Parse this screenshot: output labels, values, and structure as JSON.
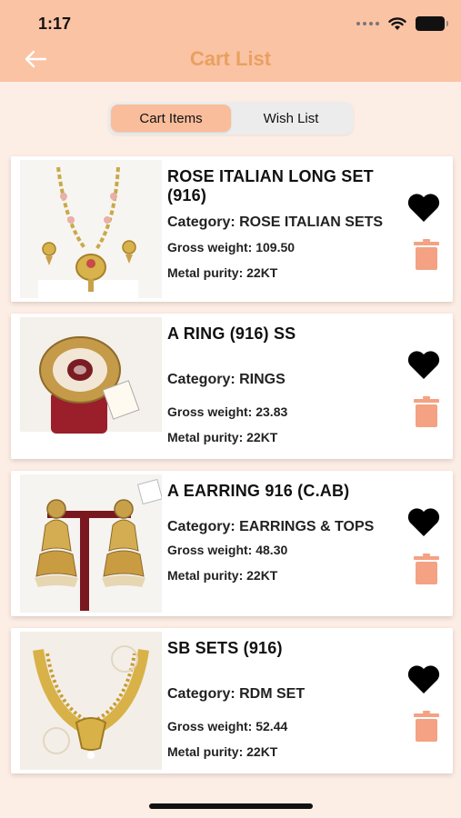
{
  "status_bar": {
    "time": "1:17"
  },
  "header": {
    "title": "Cart List"
  },
  "tabs": [
    {
      "label": "Cart Items",
      "active": true
    },
    {
      "label": "Wish List",
      "active": false
    }
  ],
  "colors": {
    "header_bg": "#fac3a4",
    "accent": "#e9a060",
    "trash": "#f4a283",
    "page_bg": "#fdeee5"
  },
  "items": [
    {
      "title": "ROSE ITALIAN LONG SET (916)",
      "category": "Category: ROSE ITALIAN SETS",
      "gross_weight": "Gross weight: 109.50",
      "purity": "Metal purity: 22KT",
      "image": "necklace-set"
    },
    {
      "title": "A RING (916) SS",
      "category": "Category: RINGS",
      "gross_weight": "Gross weight: 23.83",
      "purity": "Metal purity: 22KT",
      "image": "ring"
    },
    {
      "title": "A EARRING 916 (C.AB)",
      "category": "Category: EARRINGS & TOPS",
      "gross_weight": "Gross weight: 48.30",
      "purity": "Metal purity: 22KT",
      "image": "earrings"
    },
    {
      "title": "SB SETS (916)",
      "category": "Category: RDM SET",
      "gross_weight": "Gross weight: 52.44",
      "purity": "Metal purity: 22KT",
      "image": "gold-necklace"
    }
  ]
}
